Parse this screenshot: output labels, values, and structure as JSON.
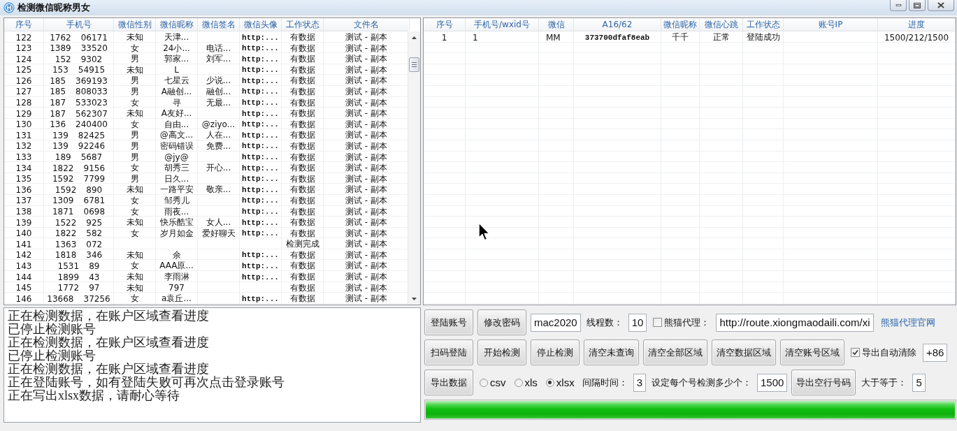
{
  "window": {
    "title": "检测微信昵称男女"
  },
  "records_table": {
    "columns": [
      "序号",
      "手机号",
      "微信性别",
      "微信昵称",
      "微信签名",
      "微信头像",
      "工作状态",
      "文件名"
    ],
    "rows": [
      {
        "index": "122",
        "phone": [
          "1762",
          "06171"
        ],
        "gender": "未知",
        "nickname": "天津...",
        "avatar": "http:...",
        "status": "有数据",
        "file": "测试 - 副本"
      },
      {
        "index": "123",
        "phone": [
          "1389",
          "33520"
        ],
        "gender": "女",
        "nickname": "24小...",
        "signature": "电话...",
        "avatar": "http:...",
        "status": "有数据",
        "file": "测试 - 副本"
      },
      {
        "index": "124",
        "phone": [
          "152",
          "9302"
        ],
        "gender": "男",
        "nickname": "郭家...",
        "signature": "刘军...",
        "avatar": "http:...",
        "status": "有数据",
        "file": "测试 - 副本"
      },
      {
        "index": "125",
        "phone": [
          "153",
          "54915"
        ],
        "gender": "未知",
        "nickname": "L",
        "avatar": "http:...",
        "status": "有数据",
        "file": "测试 - 副本"
      },
      {
        "index": "126",
        "phone": [
          "185",
          "369193"
        ],
        "gender": "男",
        "nickname": "七星云",
        "signature": "少说...",
        "avatar": "http:...",
        "status": "有数据",
        "file": "测试 - 副本"
      },
      {
        "index": "127",
        "phone": [
          "185",
          "808033"
        ],
        "gender": "男",
        "nickname": "A融创...",
        "signature": "融创...",
        "avatar": "http:...",
        "status": "有数据",
        "file": "测试 - 副本"
      },
      {
        "index": "128",
        "phone": [
          "187",
          "533023"
        ],
        "gender": "女",
        "nickname": "寻",
        "signature": "无最...",
        "avatar": "http:...",
        "status": "有数据",
        "file": "测试 - 副本"
      },
      {
        "index": "129",
        "phone": [
          "187",
          "562307"
        ],
        "gender": "未知",
        "nickname": "A友好...",
        "avatar": "http:...",
        "status": "有数据",
        "file": "测试 - 副本"
      },
      {
        "index": "130",
        "phone": [
          "136",
          "240400"
        ],
        "gender": "女",
        "nickname": "自由...",
        "signature": "@ziyo...",
        "avatar": "http:...",
        "status": "有数据",
        "file": "测试 - 副本"
      },
      {
        "index": "131",
        "phone": [
          "139",
          "82425"
        ],
        "gender": "男",
        "nickname": "@高文...",
        "signature": "人在...",
        "avatar": "http:...",
        "status": "有数据",
        "file": "测试 - 副本"
      },
      {
        "index": "132",
        "phone": [
          "139",
          "92246"
        ],
        "gender": "男",
        "nickname": "密码错误",
        "signature": "免费...",
        "avatar": "http:...",
        "status": "有数据",
        "file": "测试 - 副本"
      },
      {
        "index": "133",
        "phone": [
          "189",
          "5687"
        ],
        "gender": "男",
        "nickname": "@jy@",
        "avatar": "http:...",
        "status": "有数据",
        "file": "测试 - 副本"
      },
      {
        "index": "134",
        "phone": [
          "1822",
          "9156"
        ],
        "gender": "女",
        "nickname": "胡秀三",
        "signature": "开心...",
        "avatar": "http:...",
        "status": "有数据",
        "file": "测试 - 副本"
      },
      {
        "index": "135",
        "phone": [
          "1592",
          "7799"
        ],
        "gender": "男",
        "nickname": "日久...",
        "avatar": "http:...",
        "status": "有数据",
        "file": "测试 - 副本"
      },
      {
        "index": "136",
        "phone": [
          "1592",
          "890"
        ],
        "gender": "未知",
        "nickname": "一路平安",
        "signature": "敬亲...",
        "avatar": "http:...",
        "status": "有数据",
        "file": "测试 - 副本"
      },
      {
        "index": "137",
        "phone": [
          "1309",
          "6781"
        ],
        "gender": "女",
        "nickname": "邹秀儿",
        "avatar": "http:...",
        "status": "有数据",
        "file": "测试 - 副本"
      },
      {
        "index": "138",
        "phone": [
          "1871",
          "0698"
        ],
        "gender": "女",
        "nickname": "雨夜...",
        "avatar": "http:...",
        "status": "有数据",
        "file": "测试 - 副本"
      },
      {
        "index": "139",
        "phone": [
          "1522",
          "925"
        ],
        "gender": "未知",
        "nickname": "快乐酷宝",
        "signature": "女人...",
        "avatar": "http:...",
        "status": "有数据",
        "file": "测试 - 副本"
      },
      {
        "index": "140",
        "phone": [
          "1822",
          "582"
        ],
        "gender": "女",
        "nickname": "岁月如金",
        "signature": "爱好聊天",
        "avatar": "http:...",
        "status": "有数据",
        "file": "测试 - 副本"
      },
      {
        "index": "141",
        "phone": [
          "1363",
          "072"
        ],
        "status": "检测完成",
        "file": "测试 - 副本"
      },
      {
        "index": "142",
        "phone": [
          "1818",
          "346"
        ],
        "gender": "未知",
        "nickname": "余",
        "avatar": "http:...",
        "status": "有数据",
        "file": "测试 - 副本"
      },
      {
        "index": "143",
        "phone": [
          "1531",
          "89"
        ],
        "gender": "女",
        "nickname": "AAA原...",
        "avatar": "http:...",
        "status": "有数据",
        "file": "测试 - 副本"
      },
      {
        "index": "144",
        "phone": [
          "1899",
          "43"
        ],
        "gender": "未知",
        "nickname": "李雨淋",
        "avatar": "http:...",
        "status": "有数据",
        "file": "测试 - 副本"
      },
      {
        "index": "145",
        "phone": [
          "1772",
          "97"
        ],
        "gender": "未知",
        "nickname": "797",
        "status": "有数据",
        "file": "测试 - 副本"
      },
      {
        "index": "146",
        "phone": [
          "13668",
          "37256"
        ],
        "gender": "女",
        "nickname": "a袁丘...",
        "avatar": "http:...",
        "status": "有数据",
        "file": "测试 - 副本"
      }
    ]
  },
  "accounts_table": {
    "columns": [
      "序号",
      "手机号/wxid号",
      "微信",
      "A16/62",
      "微信昵称",
      "微信心跳",
      "工作状态",
      "账号IP",
      "进度"
    ],
    "rows": [
      {
        "index": "1",
        "phone": "1",
        "password": "MM",
        "a16": "373700dfaf8eab",
        "nickname": "千千",
        "heartbeat": "正常",
        "status": "登陆成功",
        "progress": "1500/212/1500"
      }
    ]
  },
  "log": {
    "lines": [
      "正在检测数据，在账户区域查看进度",
      "已停止检测账号",
      "正在检测数据，在账户区域查看进度",
      "已停止检测账号",
      "正在检测数据，在账户区域查看进度",
      "正在登陆账号，如有登陆失败可再次点击登录账号",
      "正在写出xlsx数据，请耐心等待"
    ]
  },
  "controls": [
    [
      {
        "kind": "button",
        "label": "登陆账号"
      },
      {
        "kind": "button",
        "label": "修改密码"
      },
      {
        "kind": "field",
        "value": "mac2020"
      },
      {
        "kind": "label",
        "text": "线程数："
      },
      {
        "kind": "field",
        "value": "10"
      },
      {
        "kind": "checkbox",
        "label": "熊猫代理：",
        "checked": false
      },
      {
        "kind": "field",
        "value": "http://route.xiongmaodaili.com/xi"
      },
      {
        "kind": "link",
        "text": "熊猫代理官网"
      }
    ],
    [
      {
        "kind": "button",
        "label": "扫码登陆"
      },
      {
        "kind": "button",
        "label": "开始检测"
      },
      {
        "kind": "button",
        "label": "停止检测"
      },
      {
        "kind": "button",
        "label": "清空未查询"
      },
      {
        "kind": "button",
        "label": "清空全部区域"
      },
      {
        "kind": "button",
        "label": "清空数据区域"
      },
      {
        "kind": "button",
        "label": "清空账号区域"
      },
      {
        "kind": "checkbox",
        "label": "导出自动清除",
        "checked": true
      },
      {
        "kind": "field",
        "value": "+86"
      }
    ],
    [
      {
        "kind": "button",
        "label": "导出数据"
      },
      {
        "kind": "radio",
        "label": "csv",
        "selected": false
      },
      {
        "kind": "radio",
        "label": "xls",
        "selected": false
      },
      {
        "kind": "radio",
        "label": "xlsx",
        "selected": true
      },
      {
        "kind": "label",
        "text": "间隔时间："
      },
      {
        "kind": "field",
        "value": "3"
      },
      {
        "kind": "label",
        "text": "设定每个号检测多少个："
      },
      {
        "kind": "field",
        "value": "1500"
      },
      {
        "kind": "button",
        "label": "导出空行号码"
      },
      {
        "kind": "label",
        "text": "大于等于："
      },
      {
        "kind": "field",
        "value": "5"
      }
    ]
  ],
  "progress": {
    "level": 1
  }
}
